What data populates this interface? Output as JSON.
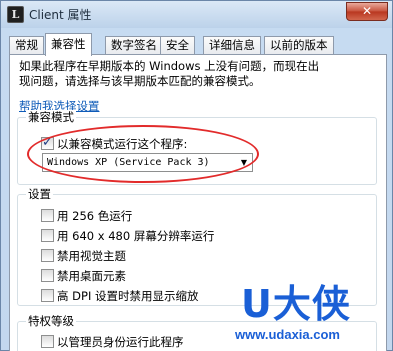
{
  "window": {
    "icon_letter": "L",
    "title": "Client 属性",
    "close_glyph": "✕"
  },
  "tabs": [
    {
      "label": "常规"
    },
    {
      "label": "兼容性"
    },
    {
      "label": "数字签名"
    },
    {
      "label": "安全"
    },
    {
      "label": "详细信息"
    },
    {
      "label": "以前的版本"
    }
  ],
  "active_tab": "兼容性",
  "description": "如果此程序在早期版本的 Windows 上没有问题，而现在出现问题，请选择与该早期版本匹配的兼容模式。",
  "help_link": "帮助我选择设置",
  "compat_mode": {
    "group_label": "兼容模式",
    "checkbox_label": "以兼容模式运行这个程序:",
    "checked": true,
    "selected_os": "Windows XP (Service Pack 3)"
  },
  "settings": {
    "group_label": "设置",
    "items": [
      {
        "label": "用 256 色运行",
        "checked": false
      },
      {
        "label": "用 640 x 480 屏幕分辨率运行",
        "checked": false
      },
      {
        "label": "禁用视觉主题",
        "checked": false
      },
      {
        "label": "禁用桌面元素",
        "checked": false
      },
      {
        "label": "高 DPI 设置时禁用显示缩放",
        "checked": false
      }
    ]
  },
  "privilege": {
    "group_label": "特权等级",
    "items": [
      {
        "label": "以管理员身份运行此程序",
        "checked": false
      }
    ]
  },
  "watermark": {
    "logo": "U大侠",
    "url": "www.udaxia.com"
  },
  "colors": {
    "link": "#0e5bb8",
    "highlight_ring": "#e22b2b",
    "watermark": "#1a5fd6",
    "close_button": "#c7513b"
  }
}
